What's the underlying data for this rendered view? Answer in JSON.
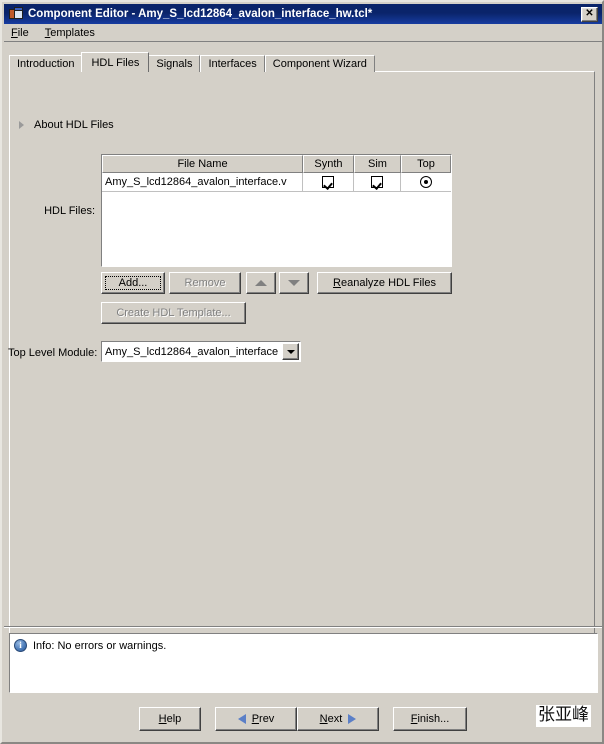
{
  "window": {
    "title": "Component Editor - Amy_S_lcd12864_avalon_interface_hw.tcl*",
    "icon": "component-editor-icon",
    "close_label": "✕"
  },
  "menubar": {
    "items": [
      {
        "label": "File",
        "mnemonic": "F",
        "rest": "ile"
      },
      {
        "label": "Templates",
        "mnemonic": "T",
        "rest": "emplates"
      }
    ]
  },
  "tabs": [
    {
      "label": "Introduction",
      "active": false
    },
    {
      "label": "HDL Files",
      "active": true
    },
    {
      "label": "Signals",
      "active": false
    },
    {
      "label": "Interfaces",
      "active": false
    },
    {
      "label": "Component Wizard",
      "active": false
    }
  ],
  "main": {
    "about": {
      "label": "About HDL Files",
      "expander_icon": "triangle-right-icon",
      "expanded": false
    },
    "hdl_files_label": "HDL Files:",
    "table": {
      "columns": [
        "File Name",
        "Synth",
        "Sim",
        "Top"
      ],
      "rows": [
        {
          "file_name": "Amy_S_lcd12864_avalon_interface.v",
          "synth": true,
          "sim": true,
          "top": true
        }
      ]
    },
    "buttons": {
      "add": {
        "label": "Add...",
        "enabled": true,
        "focused": true
      },
      "remove": {
        "label": "Remove",
        "enabled": false
      },
      "move_up": {
        "label": "",
        "icon": "triangle-up-icon",
        "enabled": false
      },
      "move_down": {
        "label": "",
        "icon": "triangle-down-icon",
        "enabled": false
      },
      "reanalyze": {
        "label": "Reanalyze HDL Files",
        "mnemonic": "R",
        "rest": "eanalyze HDL Files",
        "enabled": true
      },
      "create_template": {
        "label": "Create HDL Template...",
        "enabled": false
      }
    },
    "top_level_module": {
      "label": "Top Level Module:",
      "value": "Amy_S_lcd12864_avalon_interface",
      "dropdown_icon": "chevron-down-icon"
    }
  },
  "console": {
    "icon": "info-icon",
    "icon_glyph": "i",
    "message": "Info: No errors or warnings."
  },
  "footer": {
    "buttons": [
      {
        "name": "help",
        "mnemonic": "H",
        "rest": "elp",
        "icon": "none"
      },
      {
        "name": "prev",
        "mnemonic": "P",
        "rest": "rev",
        "icon": "arrow-left-icon"
      },
      {
        "name": "next",
        "mnemonic": "N",
        "rest": "ext",
        "icon": "arrow-right-icon"
      },
      {
        "name": "finish",
        "mnemonic": "F",
        "rest": "inish...",
        "icon": "none"
      }
    ],
    "watermark": "张亚峰"
  },
  "colors": {
    "titlebar_start": "#0a246a",
    "titlebar_end": "#173ca0",
    "face": "#d4d0c8",
    "field": "#ffffff",
    "disabled_text": "#808080",
    "arrow_blue": "#5b7fc7"
  }
}
